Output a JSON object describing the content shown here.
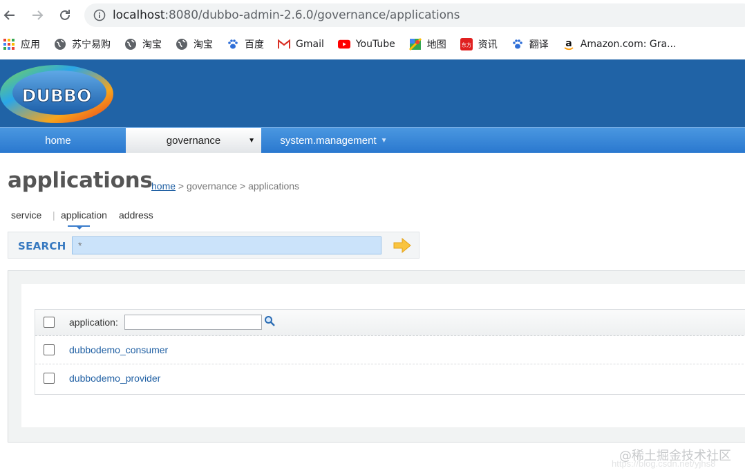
{
  "browser": {
    "url_host": "localhost",
    "url_path": ":8080/dubbo-admin-2.6.0/governance/applications",
    "bookmarks": [
      {
        "label": "应用",
        "icon": "apps-grid-icon"
      },
      {
        "label": "苏宁易购",
        "icon": "globe-icon"
      },
      {
        "label": "淘宝",
        "icon": "globe-icon"
      },
      {
        "label": "淘宝",
        "icon": "globe-icon"
      },
      {
        "label": "百度",
        "icon": "baidu-paw-icon"
      },
      {
        "label": "Gmail",
        "icon": "gmail-icon"
      },
      {
        "label": "YouTube",
        "icon": "youtube-icon"
      },
      {
        "label": "地图",
        "icon": "maps-icon"
      },
      {
        "label": "资讯",
        "icon": "dongfang-icon"
      },
      {
        "label": "翻译",
        "icon": "baidu-paw-icon"
      },
      {
        "label": "Amazon.com: Gra...",
        "icon": "amazon-icon"
      }
    ]
  },
  "logo_text": "DUBBO",
  "topnav": {
    "home": "home",
    "governance": "governance",
    "system": "system.management"
  },
  "page": {
    "title": "applications",
    "breadcrumb_home": "home",
    "breadcrumb_rest": " > governance > applications"
  },
  "subtabs": {
    "service": "service",
    "separator": "|",
    "application": "application",
    "address": "address"
  },
  "search": {
    "label": "SEARCH",
    "value": "*"
  },
  "table": {
    "filter_label": "application:",
    "filter_value": "",
    "rows": [
      "dubbodemo_consumer",
      "dubbodemo_provider"
    ]
  },
  "watermark": {
    "text": "@稀土掘金技术社区",
    "url": "https://blog.csdn.net/yjhs8"
  },
  "colors": {
    "header_blue": "#2063a6",
    "nav_blue": "#2a78cf",
    "link_blue": "#1f5fa3",
    "search_label": "#3779c0"
  }
}
